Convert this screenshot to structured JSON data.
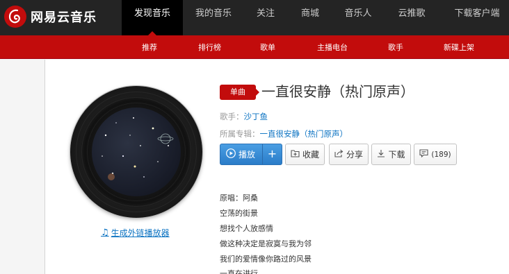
{
  "header": {
    "logo_text": "网易云音乐",
    "nav": [
      {
        "label": "发现音乐",
        "active": true
      },
      {
        "label": "我的音乐"
      },
      {
        "label": "关注"
      },
      {
        "label": "商城"
      },
      {
        "label": "音乐人"
      },
      {
        "label": "云推歌"
      },
      {
        "label": "下载客户端"
      }
    ]
  },
  "subnav": [
    "推荐",
    "排行榜",
    "歌单",
    "主播电台",
    "歌手",
    "新碟上架"
  ],
  "song": {
    "badge": "单曲",
    "title": "一直很安静（热门原声）",
    "artist_label": "歌手：",
    "artist": "沙丁鱼",
    "album_label": "所属专辑：",
    "album": "一直很安静（热门原声）"
  },
  "actions": {
    "play": "播放",
    "plus": "+",
    "collect": "收藏",
    "share": "分享",
    "download": "下载",
    "comment_count": "(189)"
  },
  "ext_link": "生成外链播放器",
  "lyrics": [
    "原唱：阿桑",
    "空荡的街景",
    "想找个人放感情",
    "做这种决定是寂寞与我为邻",
    "我们的爱情像你路过的风景",
    "一直在进行"
  ],
  "colors": {
    "brand_red": "#c20c0c",
    "topbar": "#242424",
    "link_blue": "#0c73c2"
  }
}
